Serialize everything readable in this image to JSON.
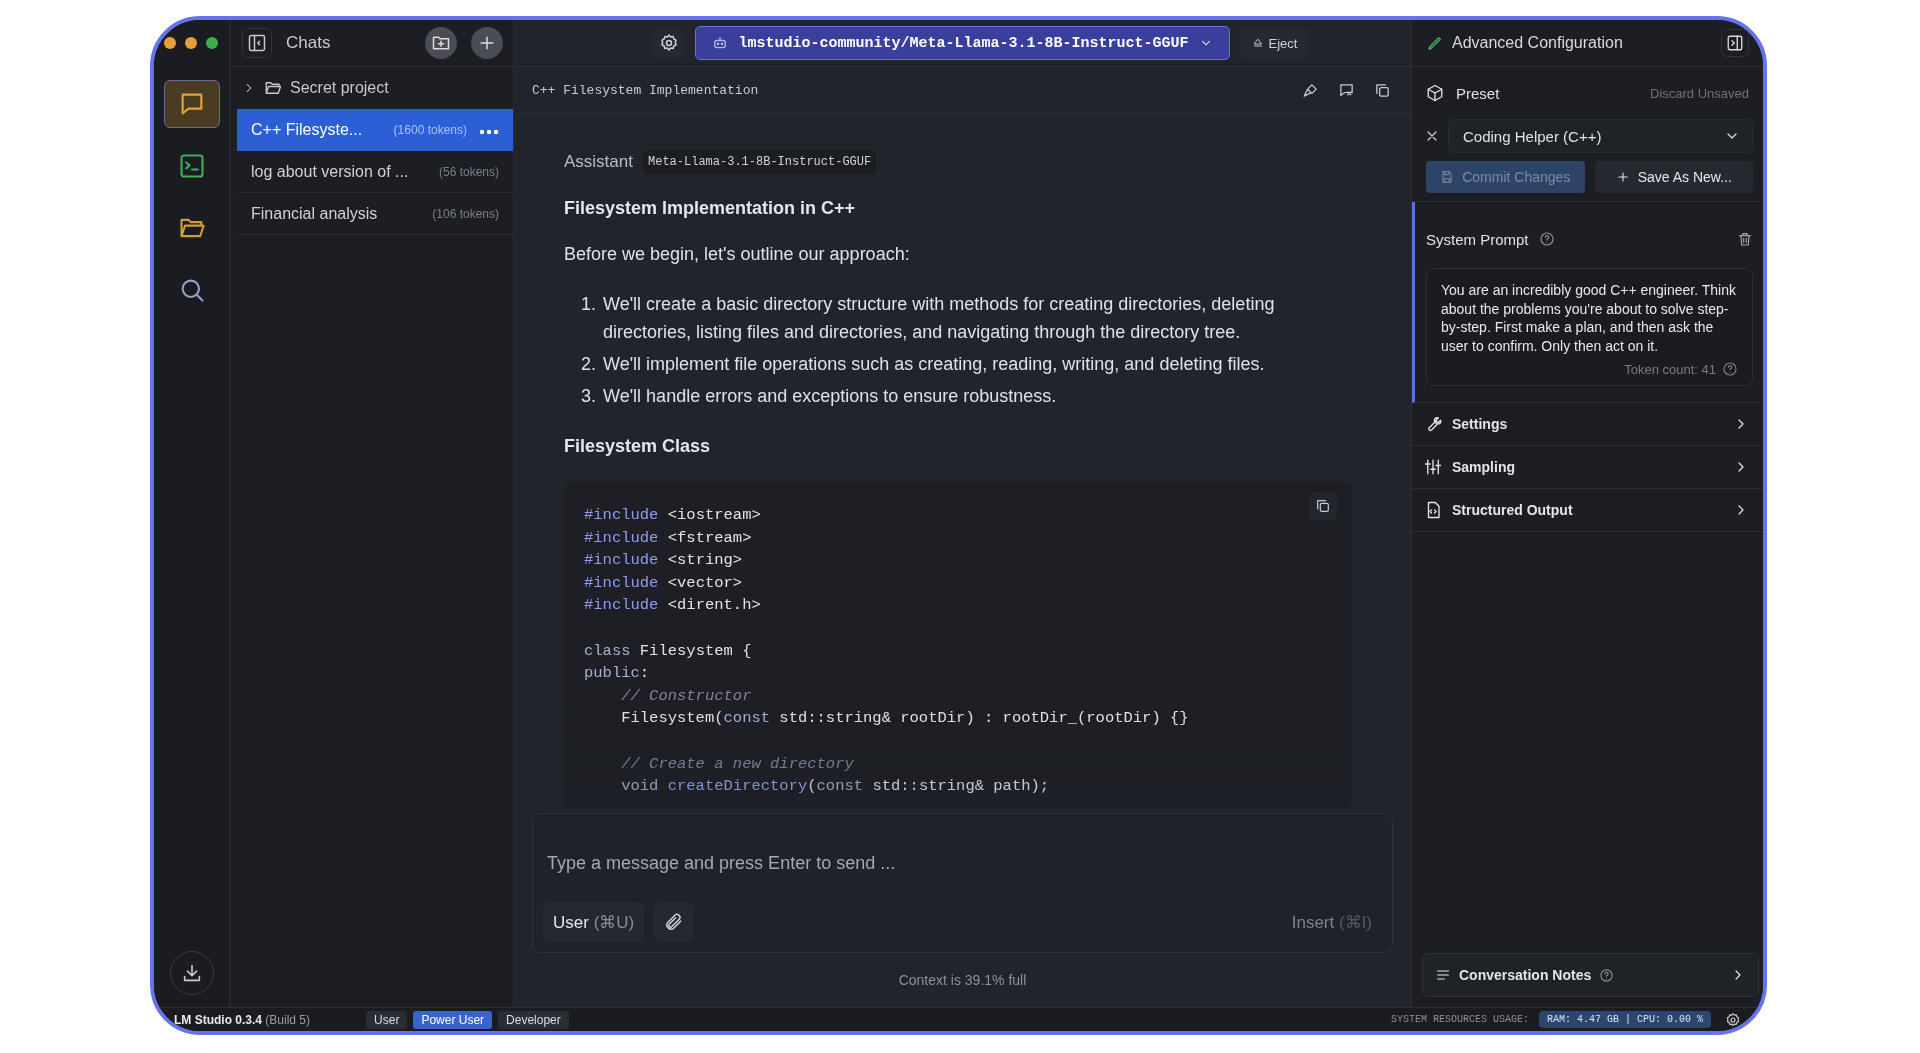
{
  "rail": {
    "items": [
      {
        "kind": "chat",
        "selected": true
      },
      {
        "kind": "terminal",
        "selected": false
      },
      {
        "kind": "folder",
        "selected": false
      },
      {
        "kind": "search",
        "selected": false
      }
    ],
    "bottom": [
      {
        "kind": "download",
        "selected": false
      }
    ]
  },
  "chats": {
    "title": "Chats",
    "folders": [
      {
        "name": "Secret project",
        "expanded": false
      }
    ],
    "items": [
      {
        "title": "C++ Filesyste...",
        "tokens": "(1600 tokens)",
        "selected": true
      },
      {
        "title": "log about version of ...",
        "tokens": "(56 tokens)",
        "selected": false
      },
      {
        "title": "Financial analysis",
        "tokens": "(106 tokens)",
        "selected": false
      }
    ]
  },
  "toolbar": {
    "model": "lmstudio-community/Meta-Llama-3.1-8B-Instruct-GGUF",
    "eject": "Eject"
  },
  "chat": {
    "title": "C++ Filesystem Implementation",
    "message": {
      "role": "Assistant",
      "model": "Meta-Llama-3.1-8B-Instruct-GGUF",
      "blocks": [
        {
          "kind": "heading",
          "text": "Filesystem Implementation in C++"
        },
        {
          "kind": "paragraph",
          "text": "Before we begin, let's outline our approach:"
        },
        {
          "kind": "list",
          "items": [
            {
              "number": "1.",
              "text": "We'll create a basic directory structure with methods for creating directories, deleting directories, listing files and directories, and navigating through the directory tree."
            },
            {
              "number": "2.",
              "text": "We'll implement file operations such as creating, reading, writing, and deleting files."
            },
            {
              "number": "3.",
              "text": "We'll handle errors and exceptions to ensure robustness."
            }
          ]
        },
        {
          "kind": "heading",
          "text": "Filesystem Class"
        },
        {
          "kind": "code",
          "lines": [
            {
              "kind": "code",
              "tokens": [
                {
                  "kind": "directive",
                  "t": "#include"
                },
                {
                  "kind": "text",
                  "t": " <iostream>"
                }
              ]
            },
            {
              "kind": "code",
              "tokens": [
                {
                  "kind": "directive",
                  "t": "#include"
                },
                {
                  "kind": "text",
                  "t": " <fstream>"
                }
              ]
            },
            {
              "kind": "code",
              "tokens": [
                {
                  "kind": "directive",
                  "t": "#include"
                },
                {
                  "kind": "text",
                  "t": " <string>"
                }
              ]
            },
            {
              "kind": "code",
              "tokens": [
                {
                  "kind": "directive",
                  "t": "#include"
                },
                {
                  "kind": "text",
                  "t": " <vector>"
                }
              ]
            },
            {
              "kind": "code",
              "tokens": [
                {
                  "kind": "directive",
                  "t": "#include"
                },
                {
                  "kind": "text",
                  "t": " <dirent.h>"
                }
              ]
            },
            {
              "kind": "blank"
            },
            {
              "kind": "code",
              "tokens": [
                {
                  "kind": "keyword",
                  "t": "class"
                },
                {
                  "kind": "text",
                  "t": " Filesystem {"
                }
              ]
            },
            {
              "kind": "code",
              "tokens": [
                {
                  "kind": "keyword",
                  "t": "public"
                },
                {
                  "kind": "text",
                  "t": ":"
                }
              ]
            },
            {
              "kind": "code",
              "tokens": [
                {
                  "kind": "comment",
                  "t": "    // Constructor"
                }
              ]
            },
            {
              "kind": "code",
              "tokens": [
                {
                  "kind": "text",
                  "t": "    Filesystem("
                },
                {
                  "kind": "keyword",
                  "t": "const"
                },
                {
                  "kind": "text",
                  "t": " std::string& rootDir) : rootDir_(rootDir) {}"
                }
              ]
            },
            {
              "kind": "blank"
            },
            {
              "kind": "code",
              "tokens": [
                {
                  "kind": "comment",
                  "t": "    // Create a new directory"
                }
              ]
            },
            {
              "kind": "code",
              "tokens": [
                {
                  "kind": "keyword",
                  "t": "    void "
                },
                {
                  "kind": "function",
                  "t": "createDirectory"
                },
                {
                  "kind": "text",
                  "t": "("
                },
                {
                  "kind": "keyword",
                  "t": "const"
                },
                {
                  "kind": "text",
                  "t": " std::string& path);"
                }
              ]
            }
          ]
        }
      ]
    },
    "composer": {
      "placeholder": "Type a message and press Enter to send ...",
      "role": "User",
      "role_shortcut": "(⌘U)",
      "insert": "Insert",
      "insert_shortcut": "(⌘I)"
    },
    "context": "Context is 39.1% full"
  },
  "config": {
    "title": "Advanced Configuration",
    "preset_label": "Preset",
    "discard": "Discard Unsaved",
    "preset": "Coding Helper (C++)",
    "commit": {
      "label": "Commit Changes",
      "disabled": true
    },
    "save_as": "Save As New...",
    "system_prompt": {
      "title": "System Prompt",
      "text": "You are an incredibly good C++ engineer. Think about the problems you're about to solve step-by-step. First make a plan, and then ask the user to confirm. Only then act on it.",
      "token_count": "Token count: 41"
    },
    "sections": [
      {
        "kind": "wrench",
        "label": "Settings"
      },
      {
        "kind": "sliders",
        "label": "Sampling"
      },
      {
        "kind": "document",
        "label": "Structured Output"
      }
    ],
    "notes": "Conversation Notes"
  },
  "status_bar": {
    "app": "LM Studio 0.3.4",
    "build": "(Build 5)",
    "modes": [
      {
        "label": "User",
        "selected": false
      },
      {
        "label": "Power User",
        "selected": true
      },
      {
        "label": "Developer",
        "selected": false
      }
    ],
    "resources_label": "SYSTEM RESOURCES USAGE:",
    "resources": "RAM: 4.47 GB | CPU: 0.00 %"
  }
}
